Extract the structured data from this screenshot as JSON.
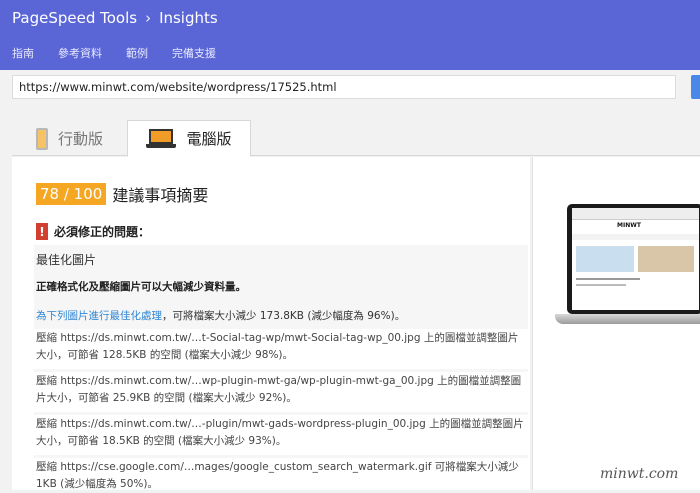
{
  "header": {
    "brand": "PageSpeed Tools",
    "separator": "›",
    "section": "Insights",
    "nav": [
      "指南",
      "參考資料",
      "範例",
      "完備支援"
    ]
  },
  "url_input": {
    "value": "https://www.minwt.com/website/wordpress/17525.html"
  },
  "tabs": [
    {
      "label": "行動版",
      "icon": "phone-icon",
      "active": false
    },
    {
      "label": "電腦版",
      "icon": "laptop-icon",
      "active": true
    }
  ],
  "summary": {
    "score": "78 / 100",
    "title": "建議事項摘要",
    "score_color": "#f5a623"
  },
  "must_fix": {
    "label": "必須修正的問題：",
    "badge": "!"
  },
  "rule": {
    "name": "最佳化圖片",
    "summary": "正確格式化及壓縮圖片可以大幅減少資料量。",
    "link_text": "為下列圖片進行最佳化處理",
    "link_suffix": "，可將檔案大小減少 173.8KB (減少幅度為 96%)。",
    "items": [
      "壓縮 https://ds.minwt.com.tw/…t-Social-tag-wp/mwt-Social-tag-wp_00.jpg 上的圖檔並調整圖片大小，可節省 128.5KB 的空間 (檔案大小減少 98%)。",
      "壓縮 https://ds.minwt.com.tw/…wp-plugin-mwt-ga/wp-plugin-mwt-ga_00.jpg 上的圖檔並調整圖片大小，可節省 25.9KB 的空間 (檔案大小減少 92%)。",
      "壓縮 https://ds.minwt.com.tw/…-plugin/mwt-gads-wordpress-plugin_00.jpg 上的圖檔並調整圖片大小，可節省 18.5KB 的空間 (檔案大小減少 93%)。",
      "壓縮 https://cse.google.com/…mages/google_custom_search_watermark.gif 可將檔案大小減少 1KB (減少幅度為 50%)。"
    ]
  },
  "preview": {
    "brand": "MINWT"
  },
  "watermark": "minwt.com"
}
